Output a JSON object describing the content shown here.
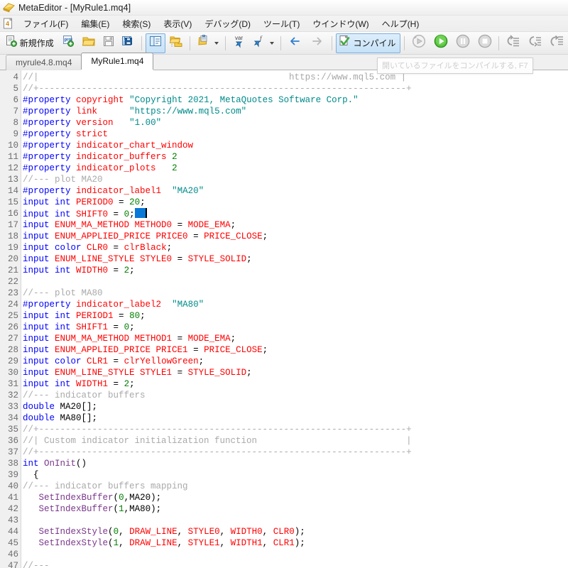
{
  "window": {
    "title": "MetaEditor - [MyRule1.mq4]",
    "app_icon": "metaeditor-logo-icon"
  },
  "menubar": {
    "doc_icon": "mq4-document-icon",
    "items": [
      {
        "label": "ファイル(F)",
        "name": "menu-file"
      },
      {
        "label": "編集(E)",
        "name": "menu-edit"
      },
      {
        "label": "検索(S)",
        "name": "menu-search"
      },
      {
        "label": "表示(V)",
        "name": "menu-view"
      },
      {
        "label": "デバッグ(D)",
        "name": "menu-debug"
      },
      {
        "label": "ツール(T)",
        "name": "menu-tools"
      },
      {
        "label": "ウインドウ(W)",
        "name": "menu-window"
      },
      {
        "label": "ヘルプ(H)",
        "name": "menu-help"
      }
    ]
  },
  "toolbar": {
    "new_label": "新規作成",
    "compile_label": "コンパイル",
    "items": [
      {
        "name": "new-file-button",
        "icon": "new-document-icon"
      },
      {
        "name": "new-project-button",
        "icon": "new-project-icon"
      },
      {
        "name": "open-file-button",
        "icon": "open-folder-icon"
      },
      {
        "name": "save-button",
        "icon": "floppy-save-icon"
      },
      {
        "name": "save-all-button",
        "icon": "floppy-save-all-icon"
      },
      {
        "name": "toggle-navigator-button",
        "icon": "navigator-panel-icon"
      },
      {
        "name": "toggle-toolbox-button",
        "icon": "toolbox-folder-icon"
      },
      {
        "name": "properties-button",
        "icon": "properties-notepad-icon"
      },
      {
        "name": "insert-variable-button",
        "icon": "var-pin-icon"
      },
      {
        "name": "insert-function-button",
        "icon": "function-pin-icon"
      },
      {
        "name": "back-button",
        "icon": "arrow-left-icon"
      },
      {
        "name": "forward-button",
        "icon": "arrow-right-icon"
      },
      {
        "name": "compile-button",
        "icon": "compile-check-icon"
      },
      {
        "name": "debug-history-button",
        "icon": "debug-replay-icon"
      },
      {
        "name": "start-debug-button",
        "icon": "play-green-icon"
      },
      {
        "name": "pause-debug-button",
        "icon": "pause-icon"
      },
      {
        "name": "stop-debug-button",
        "icon": "stop-icon"
      },
      {
        "name": "step-into-button",
        "icon": "step-into-icon"
      },
      {
        "name": "step-over-button",
        "icon": "step-over-icon"
      },
      {
        "name": "step-out-button",
        "icon": "step-out-icon"
      }
    ]
  },
  "tabs": [
    {
      "label": "myrule4.8.mq4",
      "selected": false,
      "name": "tab-myrule48"
    },
    {
      "label": "MyRule1.mq4",
      "selected": true,
      "name": "tab-myrule1"
    }
  ],
  "tooltip": {
    "text": "開いているファイルをコンパイルする, F7"
  },
  "editor": {
    "first_line_number": 4,
    "lines": [
      {
        "n": 4,
        "html": "<span class='cm'>//|                                               https://www.mql5.com |</span>"
      },
      {
        "n": 5,
        "html": "<span class='cm'>//+---------------------------------------------------------------------+</span>"
      },
      {
        "n": 6,
        "html": "<span class='k'>#property</span> <span class='id'>copyright</span> <span class='st'>\"Copyright 2021, MetaQuotes Software Corp.\"</span>"
      },
      {
        "n": 7,
        "html": "<span class='k'>#property</span> <span class='id'>link</span>      <span class='st'>\"https://www.mql5.com\"</span>"
      },
      {
        "n": 8,
        "html": "<span class='k'>#property</span> <span class='id'>version</span>   <span class='st'>\"1.00\"</span>"
      },
      {
        "n": 9,
        "html": "<span class='k'>#property</span> <span class='id'>strict</span>"
      },
      {
        "n": 10,
        "html": "<span class='k'>#property</span> <span class='id'>indicator_chart_window</span>"
      },
      {
        "n": 11,
        "html": "<span class='k'>#property</span> <span class='id'>indicator_buffers</span> <span class='num'>2</span>"
      },
      {
        "n": 12,
        "html": "<span class='k'>#property</span> <span class='id'>indicator_plots</span>   <span class='num'>2</span>"
      },
      {
        "n": 13,
        "html": "<span class='cm'>//--- plot MA20</span>"
      },
      {
        "n": 14,
        "html": "<span class='k'>#property</span> <span class='id'>indicator_label1</span>  <span class='st'>\"MA20\"</span>"
      },
      {
        "n": 15,
        "html": "<span class='k'>input int</span> <span class='id'>PERIOD0</span> = <span class='num'>20</span>;"
      },
      {
        "n": 16,
        "html": "<span class='k'>input int</span> <span class='id'>SHIFT0</span> = <span class='num'>0</span>;<span class='sel'></span><span class='caret'></span>"
      },
      {
        "n": 17,
        "html": "<span class='k'>input</span> <span class='id'>ENUM_MA_METHOD METHOD0</span> = <span class='id'>MODE_EMA</span>;"
      },
      {
        "n": 18,
        "html": "<span class='k'>input</span> <span class='id'>ENUM_APPLIED_PRICE PRICE0</span> = <span class='id'>PRICE_CLOSE</span>;"
      },
      {
        "n": 19,
        "html": "<span class='k'>input color</span> <span class='id'>CLR0</span> = <span class='id'>clrBlack</span>;"
      },
      {
        "n": 20,
        "html": "<span class='k'>input</span> <span class='id'>ENUM_LINE_STYLE STYLE0</span> = <span class='id'>STYLE_SOLID</span>;"
      },
      {
        "n": 21,
        "html": "<span class='k'>input int</span> <span class='id'>WIDTH0</span> = <span class='num'>2</span>;"
      },
      {
        "n": 22,
        "html": ""
      },
      {
        "n": 23,
        "html": "<span class='cm'>//--- plot MA80</span>"
      },
      {
        "n": 24,
        "html": "<span class='k'>#property</span> <span class='id'>indicator_label2</span>  <span class='st'>\"MA80\"</span>"
      },
      {
        "n": 25,
        "html": "<span class='k'>input int</span> <span class='id'>PERIOD1</span> = <span class='num'>80</span>;"
      },
      {
        "n": 26,
        "html": "<span class='k'>input int</span> <span class='id'>SHIFT1</span> = <span class='num'>0</span>;"
      },
      {
        "n": 27,
        "html": "<span class='k'>input</span> <span class='id'>ENUM_MA_METHOD METHOD1</span> = <span class='id'>MODE_EMA</span>;"
      },
      {
        "n": 28,
        "html": "<span class='k'>input</span> <span class='id'>ENUM_APPLIED_PRICE PRICE1</span> = <span class='id'>PRICE_CLOSE</span>;"
      },
      {
        "n": 29,
        "html": "<span class='k'>input color</span> <span class='id'>CLR1</span> = <span class='id'>clrYellowGreen</span>;"
      },
      {
        "n": 30,
        "html": "<span class='k'>input</span> <span class='id'>ENUM_LINE_STYLE STYLE1</span> = <span class='id'>STYLE_SOLID</span>;"
      },
      {
        "n": 31,
        "html": "<span class='k'>input int</span> <span class='id'>WIDTH1</span> = <span class='num'>2</span>;"
      },
      {
        "n": 32,
        "html": "<span class='cm'>//--- indicator buffers</span>"
      },
      {
        "n": 33,
        "html": "<span class='k'>double</span> <span class='pl'>MA20[];</span>"
      },
      {
        "n": 34,
        "html": "<span class='k'>double</span> <span class='pl'>MA80[];</span>"
      },
      {
        "n": 35,
        "html": "<span class='cm'>//+---------------------------------------------------------------------+</span>"
      },
      {
        "n": 36,
        "html": "<span class='cm'>//| Custom indicator initialization function                            |</span>"
      },
      {
        "n": 37,
        "html": "<span class='cm'>//+---------------------------------------------------------------------+</span>"
      },
      {
        "n": 38,
        "html": "<span class='k'>int</span> <span class='fn'>OnInit</span>()"
      },
      {
        "n": 39,
        "html": "  {"
      },
      {
        "n": 40,
        "html": "<span class='cm'>//--- indicator buffers mapping</span>"
      },
      {
        "n": 41,
        "html": "   <span class='fn'>SetIndexBuffer</span>(<span class='num'>0</span>,MA20);"
      },
      {
        "n": 42,
        "html": "   <span class='fn'>SetIndexBuffer</span>(<span class='num'>1</span>,MA80);"
      },
      {
        "n": 43,
        "html": ""
      },
      {
        "n": 44,
        "html": "   <span class='fn'>SetIndexStyle</span>(<span class='num'>0</span>, <span class='id'>DRAW_LINE</span>, <span class='id'>STYLE0</span>, <span class='id'>WIDTH0</span>, <span class='id'>CLR0</span>);"
      },
      {
        "n": 45,
        "html": "   <span class='fn'>SetIndexStyle</span>(<span class='num'>1</span>, <span class='id'>DRAW_LINE</span>, <span class='id'>STYLE1</span>, <span class='id'>WIDTH1</span>, <span class='id'>CLR1</span>);"
      },
      {
        "n": 46,
        "html": ""
      },
      {
        "n": 47,
        "html": "<span class='cm'>//---</span>"
      }
    ]
  },
  "colors": {
    "keyword": "#0000ff",
    "identifier": "#ff0000",
    "string": "#008b8b",
    "comment": "#a9a9a9",
    "number": "#008000",
    "function": "#7a378b",
    "selection": "#0a78d7",
    "compile_accent": "#7eaedd"
  }
}
